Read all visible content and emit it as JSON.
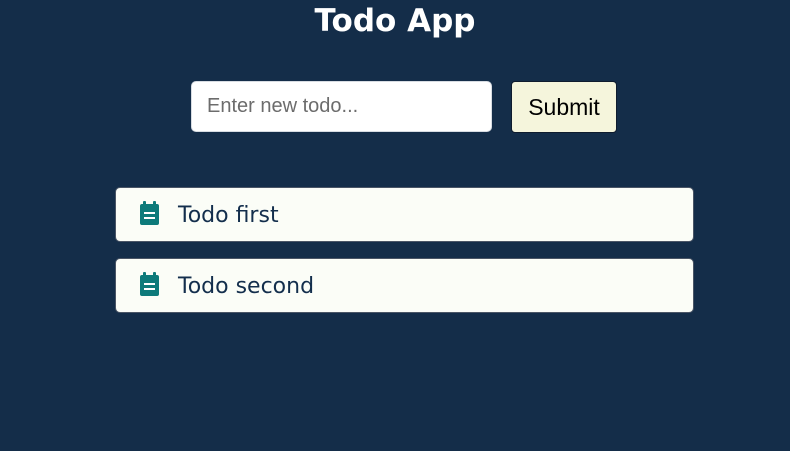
{
  "app": {
    "title": "Todo App"
  },
  "form": {
    "input_placeholder": "Enter new todo...",
    "input_value": "",
    "submit_label": "Submit"
  },
  "todos": [
    {
      "icon": "clipboard-icon",
      "text": "Todo first"
    },
    {
      "icon": "clipboard-icon",
      "text": "Todo second"
    }
  ],
  "colors": {
    "background": "#142d49",
    "title": "#ffffff",
    "submit_background": "#f5f5dc",
    "todo_item_background": "#fbfdf7",
    "todo_text": "#132e4c",
    "todo_icon": "#0d7a7a"
  }
}
